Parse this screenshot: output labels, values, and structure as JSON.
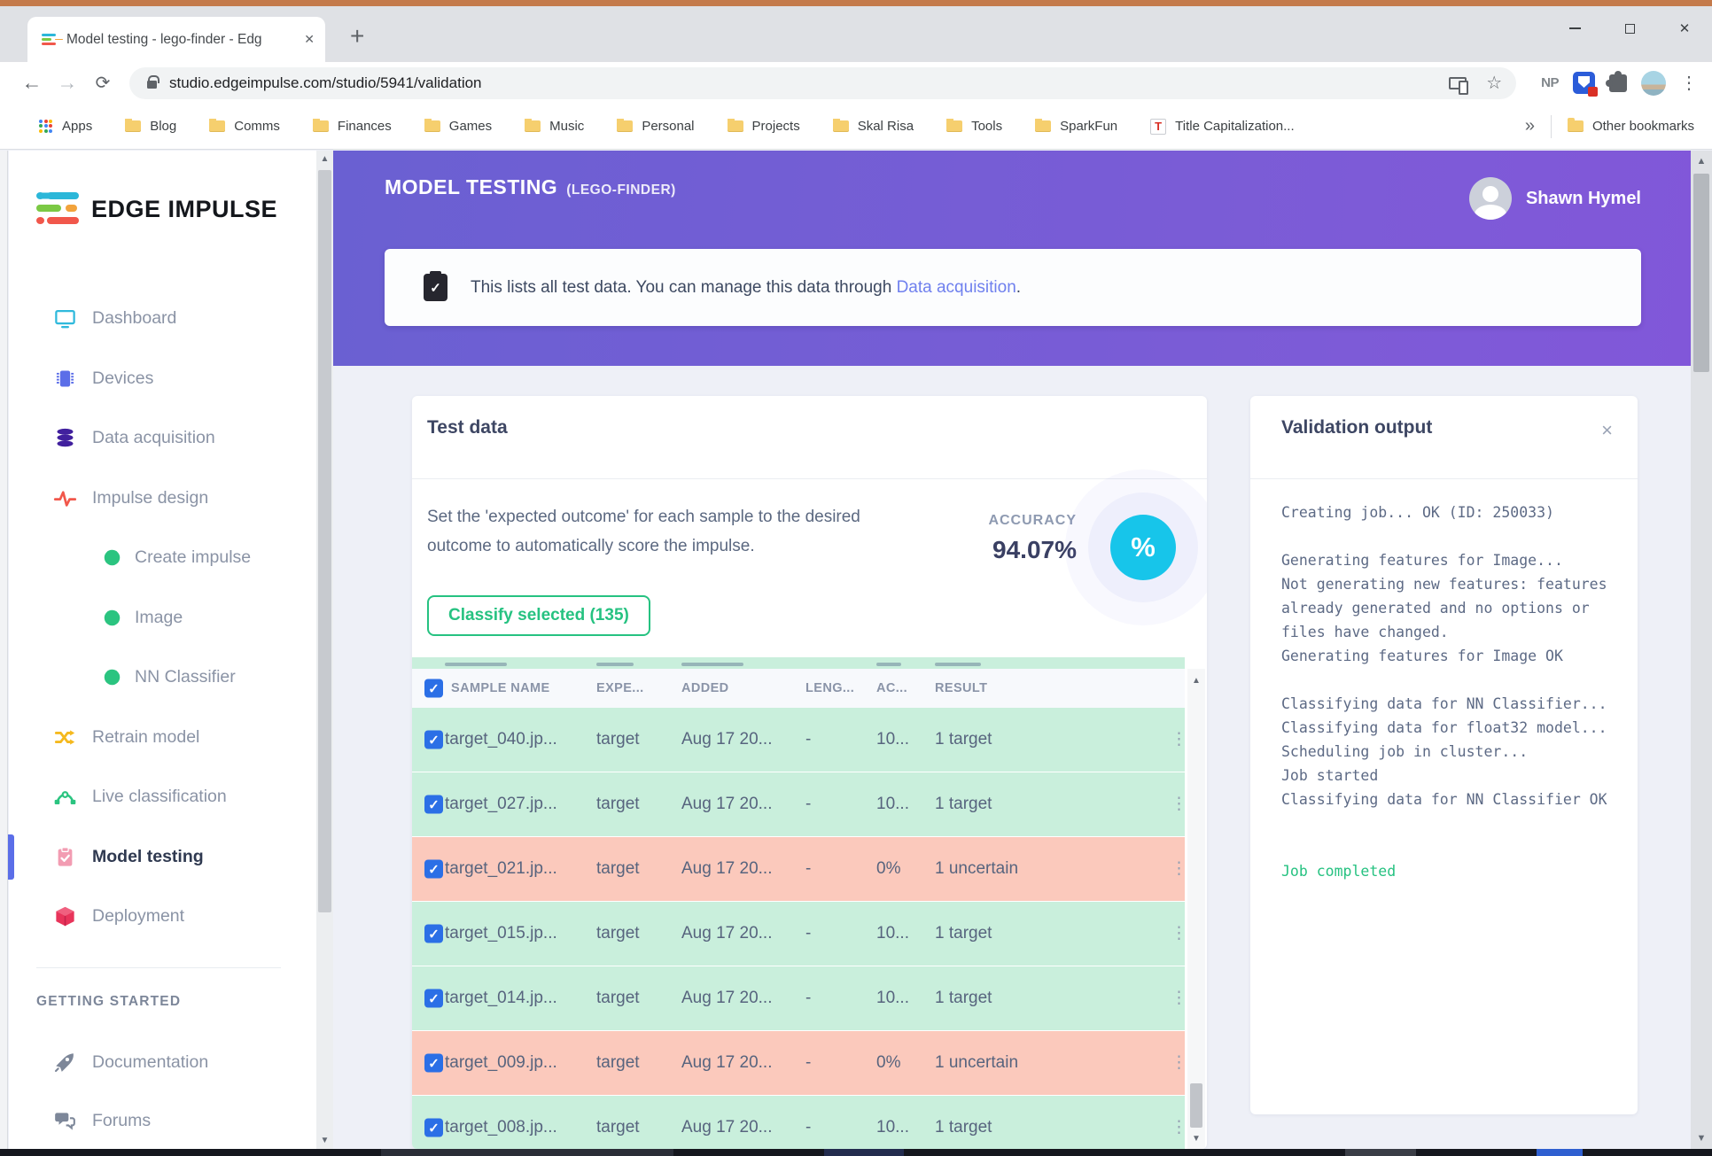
{
  "colors": {
    "frame_orange": "#c47a4b",
    "header_purple_left": "#6a60d2",
    "header_purple_right": "#8157d9",
    "accent_cyan": "#17c5ea",
    "success_green": "#26c281",
    "row_green": "#c9efdc",
    "row_pink": "#fbc9bc",
    "checkbox_blue": "#2b6fe6",
    "link_blue": "#6f80ee"
  },
  "browser": {
    "tab_title": "Model testing - lego-finder - Edg",
    "url": "studio.edgeimpulse.com/studio/5941/validation",
    "extensions_badge": "NP",
    "bookmarks": [
      "Apps",
      "Blog",
      "Comms",
      "Finances",
      "Games",
      "Music",
      "Personal",
      "Projects",
      "Skal Risa",
      "Tools",
      "SparkFun",
      "Title Capitalization..."
    ],
    "bookmarks_overflow": "»",
    "other_bookmarks": "Other bookmarks"
  },
  "sidebar": {
    "logo_text": "EDGE IMPULSE",
    "nav": [
      {
        "label": "Dashboard",
        "icon": "dashboard-icon"
      },
      {
        "label": "Devices",
        "icon": "chip-icon"
      },
      {
        "label": "Data acquisition",
        "icon": "database-icon"
      },
      {
        "label": "Impulse design",
        "icon": "waveform-icon"
      },
      {
        "label": "Create impulse",
        "icon": "green-dot-icon",
        "sub": true
      },
      {
        "label": "Image",
        "icon": "green-dot-icon",
        "sub": true
      },
      {
        "label": "NN Classifier",
        "icon": "green-dot-icon",
        "sub": true
      },
      {
        "label": "Retrain model",
        "icon": "shuffle-icon"
      },
      {
        "label": "Live classification",
        "icon": "bezier-icon"
      },
      {
        "label": "Model testing",
        "icon": "clipboard-check-icon",
        "active": true
      },
      {
        "label": "Deployment",
        "icon": "cube-icon"
      }
    ],
    "section_heading": "GETTING STARTED",
    "secondary_nav": [
      {
        "label": "Documentation",
        "icon": "rocket-icon"
      },
      {
        "label": "Forums",
        "icon": "chat-icon"
      }
    ]
  },
  "header": {
    "title": "MODEL TESTING",
    "subtitle": "(LEGO-FINDER)",
    "user_name": "Shawn Hymel",
    "banner_text": "This lists all test data. You can manage this data through ",
    "banner_link": "Data acquisition",
    "banner_suffix": "."
  },
  "test_data": {
    "card_title": "Test data",
    "description_line1": "Set the 'expected outcome' for each sample to the desired",
    "description_line2": "outcome to automatically score the impulse.",
    "accuracy_label": "ACCURACY",
    "accuracy_value": "94.07%",
    "percent_badge": "%",
    "classify_button": "Classify selected (135)",
    "table": {
      "columns": [
        "SAMPLE NAME",
        "EXPE...",
        "ADDED",
        "LENG...",
        "AC...",
        "RESULT"
      ],
      "rows": [
        {
          "name": "target_040.jp...",
          "expected": "target",
          "added": "Aug 17 20...",
          "length": "-",
          "accuracy": "10...",
          "result": "1 target",
          "status": "success"
        },
        {
          "name": "target_027.jp...",
          "expected": "target",
          "added": "Aug 17 20...",
          "length": "-",
          "accuracy": "10...",
          "result": "1 target",
          "status": "success"
        },
        {
          "name": "target_021.jp...",
          "expected": "target",
          "added": "Aug 17 20...",
          "length": "-",
          "accuracy": "0%",
          "result": "1 uncertain",
          "status": "error"
        },
        {
          "name": "target_015.jp...",
          "expected": "target",
          "added": "Aug 17 20...",
          "length": "-",
          "accuracy": "10...",
          "result": "1 target",
          "status": "success"
        },
        {
          "name": "target_014.jp...",
          "expected": "target",
          "added": "Aug 17 20...",
          "length": "-",
          "accuracy": "10...",
          "result": "1 target",
          "status": "success"
        },
        {
          "name": "target_009.jp...",
          "expected": "target",
          "added": "Aug 17 20...",
          "length": "-",
          "accuracy": "0%",
          "result": "1 uncertain",
          "status": "error"
        },
        {
          "name": "target_008.jp...",
          "expected": "target",
          "added": "Aug 17 20...",
          "length": "-",
          "accuracy": "10...",
          "result": "1 target",
          "status": "success"
        }
      ]
    }
  },
  "validation": {
    "card_title": "Validation output",
    "close_icon": "×",
    "log_lines": [
      "Creating job... OK (ID: 250033)",
      "",
      "Generating features for Image...",
      "Not generating new features: features",
      "already generated and no options or",
      "files have changed.",
      "Generating features for Image OK",
      "",
      "Classifying data for NN Classifier...",
      "Classifying data for float32 model...",
      "Scheduling job in cluster...",
      "Job started",
      "Classifying data for NN Classifier OK",
      "",
      ""
    ],
    "completed_line": "Job completed"
  }
}
